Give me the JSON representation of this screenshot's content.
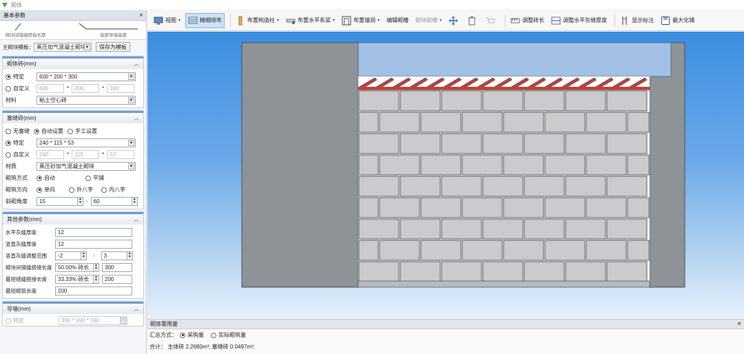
{
  "app": {
    "title": "砌体"
  },
  "left_panel": {
    "header": "基本参数",
    "diagram": {
      "label_left": "砌块间错缝搭接长度",
      "label_right": "底部导墙高度"
    },
    "template": {
      "label": "主砌块模板：",
      "value": "蒸压加气混凝土砌块",
      "save_button": "保存为模板"
    },
    "section_block": {
      "title": "砌体砖(mm)",
      "spec_label": "特定",
      "spec_value": "600 * 200 * 300",
      "custom_label": "自定义",
      "custom_values": [
        "600",
        "200",
        "300"
      ],
      "material_label": "材料",
      "material_value": "粘土空心砖"
    },
    "section_fill": {
      "title": "塞缝砖(mm)",
      "mode_options": [
        "无塞缝",
        "自动设置",
        "手工设置"
      ],
      "spec_label": "特定",
      "spec_value": "240 * 115 * 53",
      "custom_label": "自定义",
      "custom_values": [
        "240",
        "115",
        "53"
      ],
      "material_label": "材质",
      "material_value": "蒸压砂加气混凝土砌块",
      "build_label": "砌筑方式",
      "build_options": [
        "自动",
        "平铺"
      ],
      "direction_label": "砌筑方向",
      "direction_options": [
        "单向",
        "外八字",
        "内八字"
      ],
      "angle_label": "斜砌角度",
      "angle_from": "15",
      "angle_to": "60"
    },
    "section_other": {
      "title": "其他参数(mm)",
      "h_joint_label": "水平灰缝厚度",
      "h_joint_value": "12",
      "v_joint_label": "竖直灰缝厚度",
      "v_joint_value": "12",
      "v_adjust_label": "竖直灰缝调整范围",
      "v_adjust_from": "-2",
      "v_adjust_to": "3",
      "overlap_label": "砌块间错缝搭接长度",
      "overlap_pct": "50.00% 砖长",
      "overlap_value": "300",
      "min_overlap_label": "最短错缝搭接长度",
      "min_overlap_pct": "33.33% 砖长",
      "min_overlap_value": "200",
      "min_brick_label": "最短砌筑长度",
      "min_brick_value": "200"
    },
    "section_guide": {
      "title": "导墙(mm)",
      "spec_label": "特定",
      "spec_value": "390 * 190 * 190"
    }
  },
  "toolbar": {
    "items": [
      {
        "label": "视图",
        "icon": "monitor-icon",
        "dropdown": true
      },
      {
        "label": "精细排布",
        "icon": "layout-icon",
        "active": true
      },
      {
        "label": "布置构造柱",
        "icon": "column-icon",
        "dropdown": true
      },
      {
        "label": "布置水平系梁",
        "icon": "beam-icon",
        "dropdown": true
      },
      {
        "label": "布置墙洞",
        "icon": "opening-icon",
        "dropdown": true
      },
      {
        "label": "编辑砌槽"
      },
      {
        "label": "砌块砌槽",
        "gray": true,
        "dropdown": true
      },
      {
        "label": "",
        "icon": "move-icon"
      },
      {
        "label": "",
        "icon": "delete-icon"
      },
      {
        "label": "",
        "icon": "cart-icon",
        "gray": true
      },
      {
        "label": "调整砖长",
        "icon": "ruler-icon"
      },
      {
        "label": "调整水平灰缝厚度",
        "icon": "joint-icon"
      },
      {
        "label": "显示标注",
        "icon": "dimension-icon"
      },
      {
        "label": "最大化铺",
        "icon": "save-icon"
      }
    ]
  },
  "bottom_panel": {
    "title": "砌体需用量",
    "mode_label": "汇总方式：",
    "mode_options": [
      "采购量",
      "实际砌筑量"
    ],
    "summary": "合计：  主体砖 2.2680m³; 塞缝砖 0.0497m³;"
  },
  "colors": {
    "brick_fill": "#c9cbcd",
    "mortar": "#555a5e",
    "fill_brick": "#b8463c",
    "wall_gray": "#8e9398",
    "beam_blue": "#a3c0e6"
  }
}
